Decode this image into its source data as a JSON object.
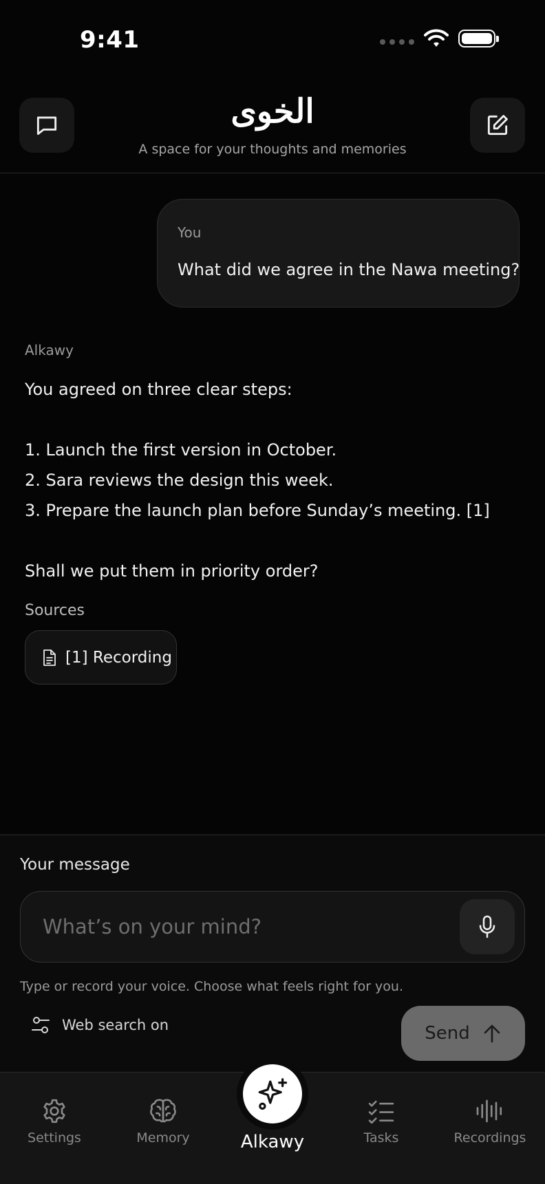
{
  "status_bar": {
    "time": "9:41"
  },
  "header": {
    "title": "الخوى",
    "subtitle": "A space for your thoughts and memories",
    "left_icon": "chat-bubble-icon",
    "right_icon": "compose-icon"
  },
  "conversation": {
    "user_message": {
      "author": "You",
      "text": "What did we agree in the Nawa meeting?"
    },
    "assistant_message": {
      "author": "Alkawy",
      "lines": [
        "You agreed on three clear steps:",
        "1. Launch the first version in October.",
        "2. Sara reviews the design this week.",
        "3. Prepare the launch plan before Sunday’s meeting. [1]",
        "Shall we put them in priority order?"
      ],
      "sources_label": "Sources",
      "sources": [
        {
          "label": "[1] Recording",
          "icon": "document-icon"
        }
      ]
    }
  },
  "composer": {
    "label": "Your message",
    "placeholder": "What’s on your mind?",
    "value": "",
    "hint": "Type or record your voice. Choose what feels right for you.",
    "web_search_label": "Web search on",
    "send_label": "Send"
  },
  "tab_bar": {
    "tabs": [
      {
        "label": "Settings",
        "icon": "gear-icon"
      },
      {
        "label": "Memory",
        "icon": "brain-icon"
      },
      {
        "label": "Alkawy",
        "icon": "sparkle-icon"
      },
      {
        "label": "Tasks",
        "icon": "checklist-icon"
      },
      {
        "label": "Recordings",
        "icon": "waveform-icon"
      }
    ]
  },
  "colors": {
    "background": "#050505",
    "surface": "#181818",
    "send_button": "#6a6a6a",
    "muted_text": "#9a9a9a"
  }
}
